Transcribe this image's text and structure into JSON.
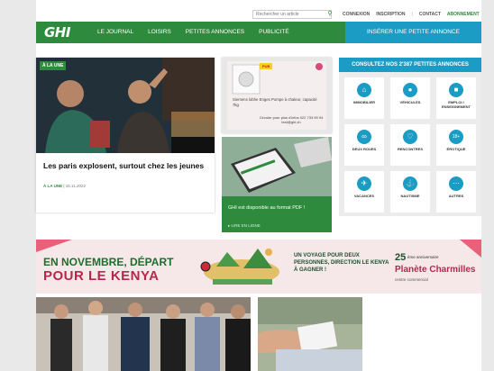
{
  "topbar": {
    "search_placeholder": "Rechercher un article",
    "links": [
      "CONNEXION",
      "INSCRIPTION",
      "CONTACT",
      "ABONNEMENT"
    ]
  },
  "navbar": {
    "logo": "GHI",
    "items": [
      "LE JOURNAL",
      "LOISIRS",
      "PETITES ANNONCES",
      "PUBLICITÉ"
    ],
    "insert_button": "INSÉRER UNE PETITE ANNONCE"
  },
  "feature": {
    "tag": "À LA UNE",
    "title": "Les paris explosent, surtout chez les jeunes",
    "meta_section": "À LA UNE",
    "meta_date": "15.11.2022"
  },
  "ad": {
    "label": "PUB",
    "text1": "Siemens lobhe Enges Pompe à chaleur, capacité 7kg",
    "text2": "Circuler pour plus d'infos 022 733 99 94 test@ghi.ch"
  },
  "pdf": {
    "text": "GHI est disponible au format PDF !",
    "link": "▸ LIRE EN LIGNE"
  },
  "annonces": {
    "title": "CONSULTEZ NOS 2'387 PETITES ANNONCES",
    "categories": [
      {
        "label": "IMMOBILIER",
        "icon": "house-icon"
      },
      {
        "label": "VÉHICULES",
        "icon": "steering-wheel-icon"
      },
      {
        "label": "EMPLOI / ENSEIGNEMENT",
        "icon": "briefcase-icon"
      },
      {
        "label": "DEUX ROUES",
        "icon": "bike-icon"
      },
      {
        "label": "RENCONTRES",
        "icon": "heart-icon"
      },
      {
        "label": "ÉROTIQUE",
        "icon": "18plus-icon"
      },
      {
        "label": "VACANCES",
        "icon": "plane-icon"
      },
      {
        "label": "NAUTISME",
        "icon": "anchor-icon"
      },
      {
        "label": "AUTRES",
        "icon": "dots-icon"
      }
    ]
  },
  "banner": {
    "line1": "EN NOVEMBRE, DÉPART",
    "line2": "POUR LE KENYA",
    "right_text": "UN VOYAGE POUR DEUX PERSONNES, DIRECTION LE KENYA À GAGNER !",
    "anniv_num": "25",
    "anniv_text": "ème anniversaire",
    "brand": "Planète Charmilles",
    "brand_sub": "centre commercial"
  },
  "colors": {
    "brand_green": "#2e8b3d",
    "accent_blue": "#1a9cc4",
    "banner_pink": "#b8274b"
  }
}
